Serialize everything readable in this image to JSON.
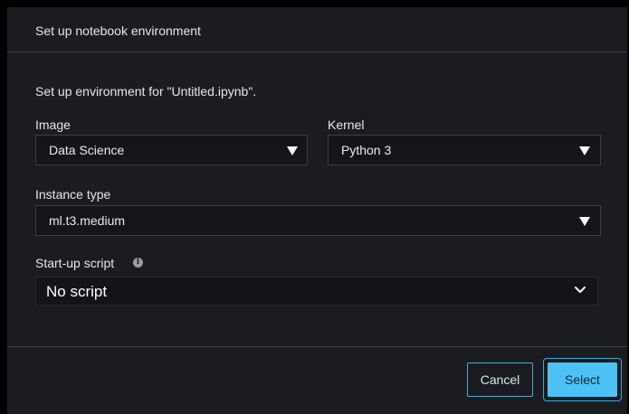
{
  "dialog": {
    "title": "Set up notebook environment",
    "setup_text": "Set up environment for \"Untitled.ipynb\"."
  },
  "image": {
    "label": "Image",
    "value": "Data Science"
  },
  "kernel": {
    "label": "Kernel",
    "value": "Python 3"
  },
  "instance_type": {
    "label": "Instance type",
    "value": "ml.t3.medium"
  },
  "startup_script": {
    "label": "Start-up script",
    "value": "No script",
    "info_icon": "info-icon"
  },
  "footer": {
    "cancel_label": "Cancel",
    "select_label": "Select"
  },
  "colors": {
    "primary_button": "#4ec2f5",
    "dialog_background": "#1b1c1f"
  }
}
